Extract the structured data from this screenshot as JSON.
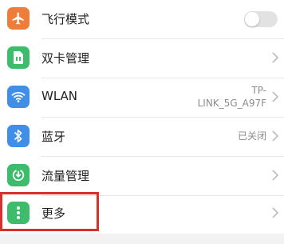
{
  "settings": {
    "items": [
      {
        "label": "飞行模式",
        "icon": "airplane-icon",
        "icon_color": "#ef7d3a",
        "control": "toggle",
        "toggle_on": false
      },
      {
        "label": "双卡管理",
        "icon": "sim-card-icon",
        "icon_color": "#3dbd6b",
        "control": "chevron"
      },
      {
        "label": "WLAN",
        "icon": "wifi-icon",
        "icon_color": "#3f8fe8",
        "control": "chevron",
        "value_line1": "TP-",
        "value_line2": "LINK_5G_A97F"
      },
      {
        "label": "蓝牙",
        "icon": "bluetooth-icon",
        "icon_color": "#3f8fe8",
        "control": "chevron",
        "value": "已关闭"
      },
      {
        "label": "流量管理",
        "icon": "data-usage-icon",
        "icon_color": "#3dbd6b",
        "control": "chevron"
      },
      {
        "label": "更多",
        "icon": "more-vertical-icon",
        "icon_color": "#3dbd6b",
        "control": "chevron",
        "highlighted": true
      }
    ]
  },
  "colors": {
    "highlight_border": "#d9302b",
    "background": "#f2f2f2",
    "chevron": "#bcbcbc"
  }
}
